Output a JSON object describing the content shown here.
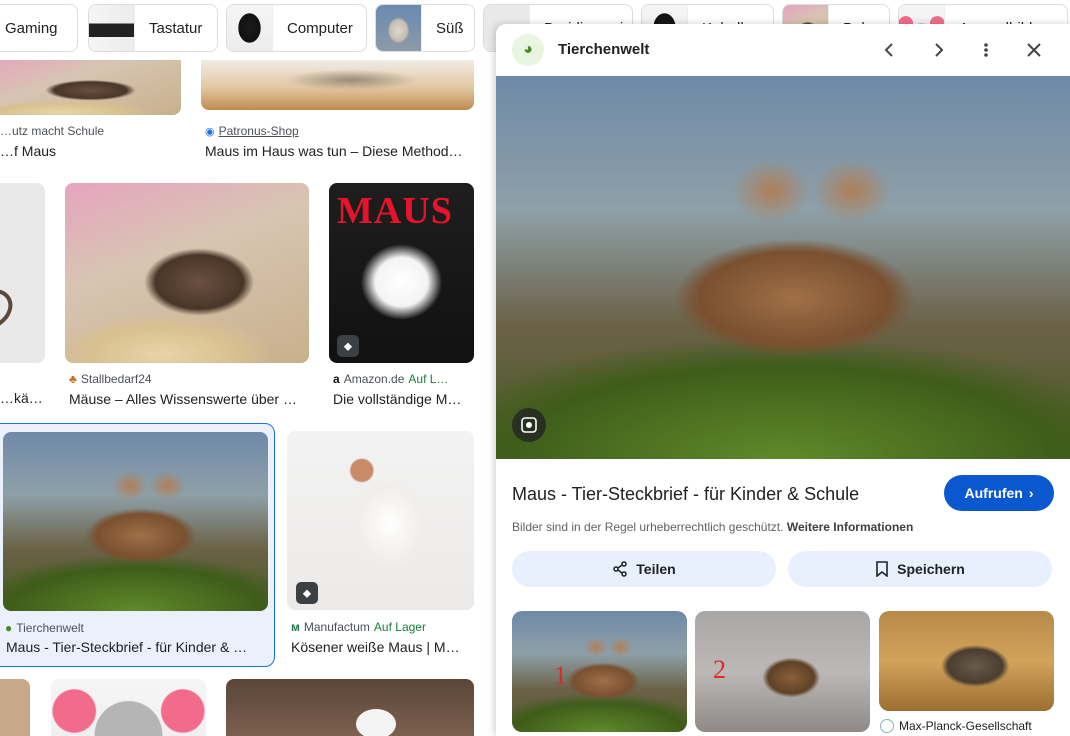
{
  "chips": [
    {
      "label": "Gaming"
    },
    {
      "label": "Tastatur"
    },
    {
      "label": "Computer"
    },
    {
      "label": "Süß"
    },
    {
      "label": "Dreidimensional"
    },
    {
      "label": "Kabellos"
    },
    {
      "label": "Bohne"
    },
    {
      "label": "Ausmalbild"
    }
  ],
  "grid": {
    "row0": {
      "left_src": "…utz macht Schule",
      "left_title": "…f Maus",
      "right_src": "Patronus-Shop",
      "right_title": "Maus im Haus was tun – Diese Method…"
    },
    "row1": {
      "left_title": "…käm…",
      "mid_src": "Stallbedarf24",
      "mid_title": "Mäuse – Alles Wissenswerte über …",
      "right_src": "Amazon.de",
      "right_stock": "Auf L…",
      "right_title": "Die vollständige M…",
      "right_img_text": "MAUS"
    },
    "row2": {
      "left_src": "Tierchenwelt",
      "left_title": "Maus - Tier-Steckbrief - für Kinder & …",
      "right_src": "Manufactum",
      "right_stock": "Auf Lager",
      "right_title": "Kösener weiße Maus | M…"
    }
  },
  "panel": {
    "site": "Tierchenwelt",
    "title": "Maus - Tier-Steckbrief - für Kinder & Schule",
    "visit_label": "Aufrufen",
    "copyright_text": "Bilder sind in der Regel urheberrechtlich geschützt.",
    "copyright_link": "Weitere Informationen",
    "share_label": "Teilen",
    "save_label": "Speichern",
    "related": [
      {
        "number": "1"
      },
      {
        "number": "2"
      },
      {
        "source": "Max-Planck-Gesellschaft"
      }
    ]
  },
  "icons": {
    "prev": "chevron-left-icon",
    "next": "chevron-right-icon",
    "more": "more-vert-icon",
    "close": "close-icon",
    "lens": "camera-lens-icon",
    "share": "share-icon",
    "bookmark": "bookmark-icon",
    "tag": "price-tag-icon"
  },
  "colors": {
    "accent": "#0b57d0",
    "pill_bg": "#e8f0fe",
    "stock_green": "#188038",
    "annotation_red": "#e02a2a"
  }
}
